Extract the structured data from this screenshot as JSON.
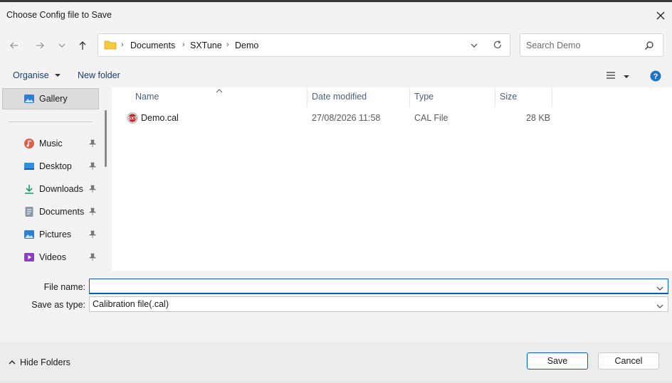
{
  "dialog": {
    "title": "Choose Config file to Save"
  },
  "breadcrumb": [
    "Documents",
    "SXTune",
    "Demo"
  ],
  "search": {
    "placeholder": "Search Demo"
  },
  "commands": {
    "organise": "Organise",
    "new_folder": "New folder"
  },
  "nav": {
    "gallery": "Gallery",
    "items": [
      {
        "label": "Music",
        "icon": "music-icon"
      },
      {
        "label": "Desktop",
        "icon": "desktop-icon"
      },
      {
        "label": "Downloads",
        "icon": "downloads-icon"
      },
      {
        "label": "Documents",
        "icon": "documents-icon"
      },
      {
        "label": "Pictures",
        "icon": "pictures-icon"
      },
      {
        "label": "Videos",
        "icon": "videos-icon"
      }
    ]
  },
  "columns": {
    "name": "Name",
    "date": "Date modified",
    "type": "Type",
    "size": "Size"
  },
  "files": [
    {
      "name": "Demo.cal",
      "date": "27/08/2026 11:58",
      "type": "CAL File",
      "size": "28 KB"
    }
  ],
  "form": {
    "file_name_label": "File name:",
    "file_name_value": "",
    "save_type_label": "Save as type:",
    "save_type_value": "Calibration file(.cal)"
  },
  "footer": {
    "hide_folders": "Hide Folders",
    "save": "Save",
    "cancel": "Cancel"
  },
  "colors": {
    "accent": "#005fb8",
    "folder": "#f7c844"
  }
}
